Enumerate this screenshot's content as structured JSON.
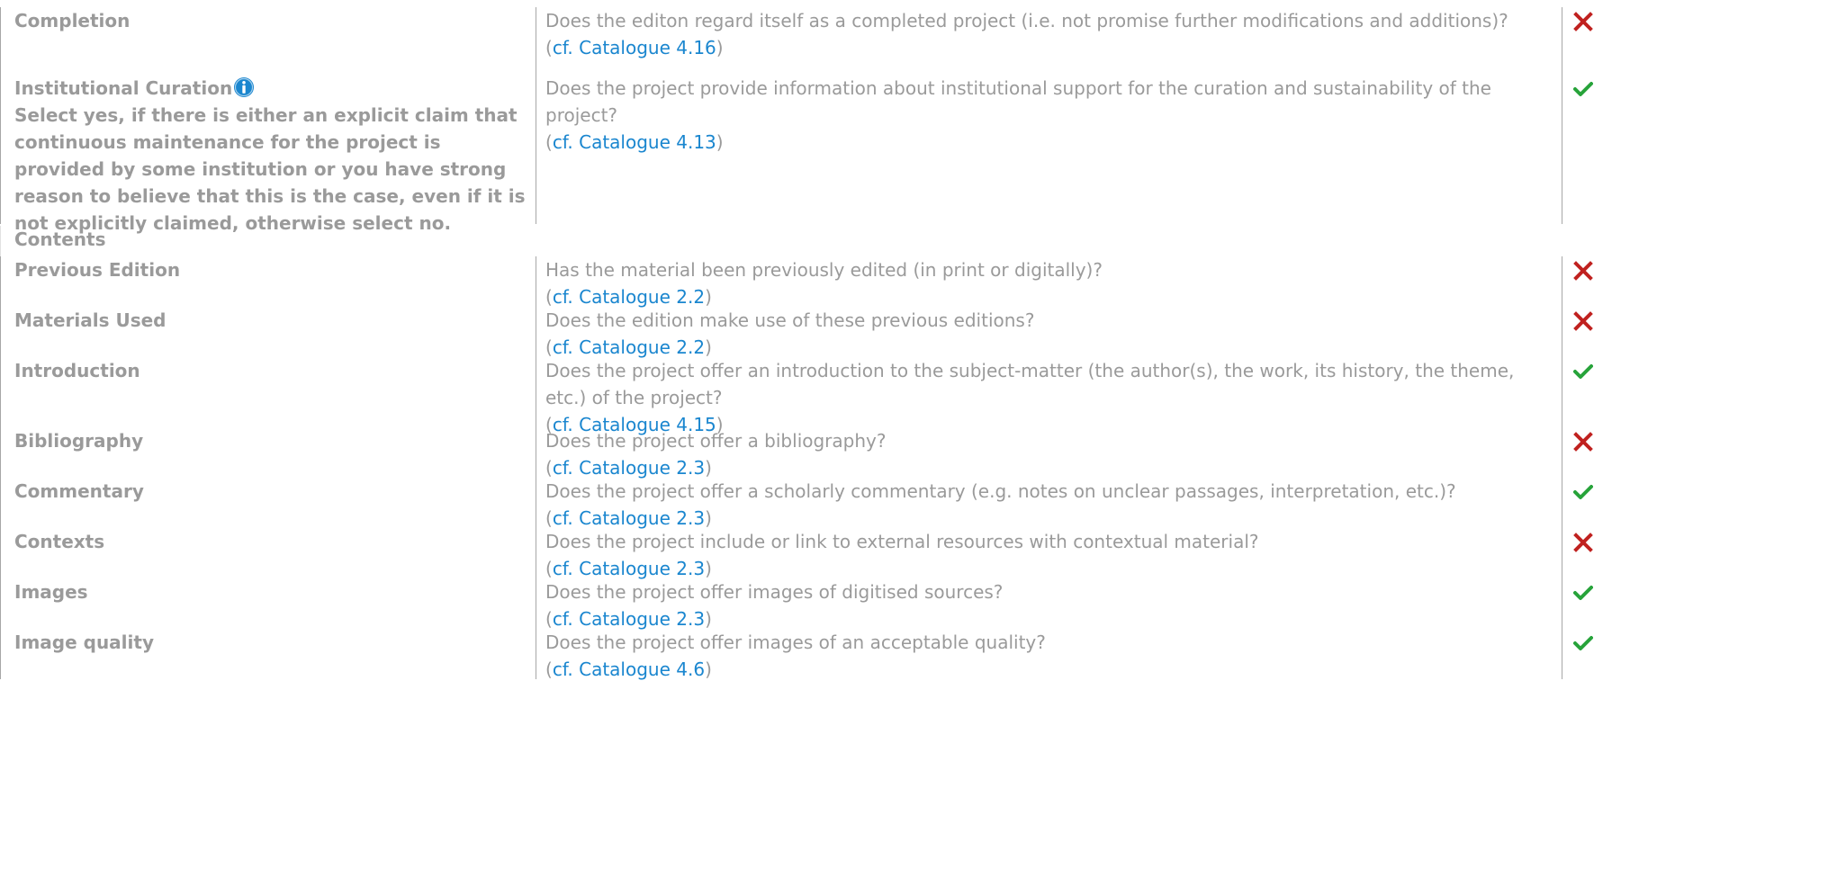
{
  "rows": [
    {
      "type": "criterion",
      "label": "Completion",
      "question": "Does the editon regard itself as a completed project (i.e. not promise further modifications and additions)?",
      "ref_prefix": "(",
      "ref_text": "cf. Catalogue 4.16",
      "ref_suffix": ")",
      "status": "no",
      "status_icon": "cross-icon"
    },
    {
      "type": "criterion",
      "label": "Institutional Curation",
      "info_icon": "info-icon",
      "rationale": "Select yes, if there is either an explicit claim that continuous maintenance for the project is provided by some institution or you have strong reason to believe that this is the case, even if it is not explicitly claimed, otherwise select no.",
      "question": "Does the project provide information about institutional support for the curation and sustainability of the project?",
      "ref_prefix": "(",
      "ref_text": "cf. Catalogue 4.13",
      "ref_suffix": ")",
      "status": "yes",
      "status_icon": "check-icon"
    },
    {
      "type": "section",
      "label": "Contents"
    },
    {
      "type": "criterion",
      "label": "Previous Edition",
      "question": "Has the material been previously edited (in print or digitally)?",
      "ref_prefix": "(",
      "ref_text": "cf. Catalogue 2.2",
      "ref_suffix": ")",
      "status": "no",
      "status_icon": "cross-icon"
    },
    {
      "type": "criterion",
      "label": "Materials Used",
      "question": "Does the edition make use of these previous editions?",
      "ref_prefix": "(",
      "ref_text": "cf. Catalogue 2.2",
      "ref_suffix": ")",
      "status": "no",
      "status_icon": "cross-icon"
    },
    {
      "type": "criterion",
      "label": "Introduction",
      "question": "Does the project offer an introduction to the subject-matter (the author(s), the work, its history, the theme, etc.) of the project?",
      "ref_prefix": "(",
      "ref_text": "cf. Catalogue 4.15",
      "ref_suffix": ")",
      "status": "yes",
      "status_icon": "check-icon"
    },
    {
      "type": "criterion",
      "label": "Bibliography",
      "question": "Does the project offer a bibliography?",
      "ref_prefix": "(",
      "ref_text": "cf. Catalogue 2.3",
      "ref_suffix": ")",
      "status": "no",
      "status_icon": "cross-icon"
    },
    {
      "type": "criterion",
      "label": "Commentary",
      "question": "Does the project offer a scholarly commentary (e.g. notes on unclear passages, interpretation, etc.)?",
      "ref_prefix": "(",
      "ref_text": "cf. Catalogue 2.3",
      "ref_suffix": ")",
      "status": "yes",
      "status_icon": "check-icon"
    },
    {
      "type": "criterion",
      "label": "Contexts",
      "question": "Does the project include or link to external resources with contextual material?",
      "ref_prefix": "(",
      "ref_text": "cf. Catalogue 2.3",
      "ref_suffix": ")",
      "status": "no",
      "status_icon": "cross-icon"
    },
    {
      "type": "criterion",
      "label": "Images",
      "question": "Does the project offer images of digitised sources?",
      "ref_prefix": "(",
      "ref_text": "cf. Catalogue 2.3",
      "ref_suffix": ")",
      "status": "yes",
      "status_icon": "check-icon"
    },
    {
      "type": "criterion",
      "label": "Image quality",
      "question": "Does the project offer images of an acceptable quality?",
      "ref_prefix": "(",
      "ref_text": "cf. Catalogue 4.6",
      "ref_suffix": ")",
      "status": "yes",
      "status_icon": "check-icon"
    }
  ],
  "colors": {
    "text": "#9a9a9a",
    "link": "#1a86cf",
    "cross": "#c0211f",
    "check": "#27a33a",
    "info": "#1a86cf",
    "border": "#a7a7a7"
  }
}
